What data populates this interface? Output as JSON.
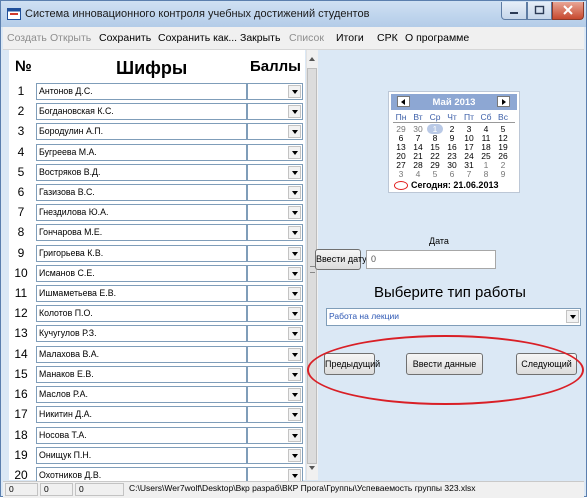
{
  "window": {
    "title": "Система инновационного контроля учебных достижений студентов",
    "controls": {
      "minimize_icon": "minimize-icon",
      "maximize_icon": "maximize-icon",
      "close_icon": "close-icon"
    }
  },
  "menu": [
    {
      "label": "Создать",
      "disabled": true
    },
    {
      "label": "Открыть",
      "disabled": true
    },
    {
      "label": "Сохранить",
      "disabled": false
    },
    {
      "label": "Сохранить как...",
      "disabled": false
    },
    {
      "label": "Закрыть",
      "disabled": false
    },
    {
      "label": "Список",
      "disabled": true
    },
    {
      "label": "Итоги",
      "disabled": false
    },
    {
      "label": "СРК",
      "disabled": false
    },
    {
      "label": "О программе",
      "disabled": false
    }
  ],
  "table": {
    "headers": {
      "num": "№",
      "code": "Шифры",
      "score": "Баллы"
    },
    "rows": [
      {
        "num": "1",
        "name": "Антонов Д.С."
      },
      {
        "num": "2",
        "name": "Богдановская К.С."
      },
      {
        "num": "3",
        "name": "Бородулин А.П."
      },
      {
        "num": "4",
        "name": "Бугреева М.А."
      },
      {
        "num": "5",
        "name": "Востряков В.Д."
      },
      {
        "num": "6",
        "name": "Газизова В.С."
      },
      {
        "num": "7",
        "name": "Гнездилова Ю.А."
      },
      {
        "num": "8",
        "name": "Гончарова М.Е."
      },
      {
        "num": "9",
        "name": "Григорьева К.В."
      },
      {
        "num": "10",
        "name": "Исманов С.Е."
      },
      {
        "num": "11",
        "name": "Ишмаметьева Е.В."
      },
      {
        "num": "12",
        "name": "Колотов П.О."
      },
      {
        "num": "13",
        "name": "Кучугулов Р.З."
      },
      {
        "num": "14",
        "name": "Малахова В.А."
      },
      {
        "num": "15",
        "name": "Манаков Е.В."
      },
      {
        "num": "16",
        "name": "Маслов Р.А."
      },
      {
        "num": "17",
        "name": "Никитин Д.А."
      },
      {
        "num": "18",
        "name": "Носова Т.А."
      },
      {
        "num": "19",
        "name": "Онищук П.Н."
      },
      {
        "num": "20",
        "name": "Охотников Д.В."
      }
    ]
  },
  "calendar": {
    "month_label": "Май 2013",
    "weekdays": [
      "Пн",
      "Вт",
      "Ср",
      "Чт",
      "Пт",
      "Сб",
      "Вс"
    ],
    "weeks": [
      [
        "29",
        "30",
        "1",
        "2",
        "3",
        "4",
        "5"
      ],
      [
        "6",
        "7",
        "8",
        "9",
        "10",
        "11",
        "12"
      ],
      [
        "13",
        "14",
        "15",
        "16",
        "17",
        "18",
        "19"
      ],
      [
        "20",
        "21",
        "22",
        "23",
        "24",
        "25",
        "26"
      ],
      [
        "27",
        "28",
        "29",
        "30",
        "31",
        "1",
        "2"
      ],
      [
        "3",
        "4",
        "5",
        "6",
        "7",
        "8",
        "9"
      ]
    ],
    "today_label": "Сегодня: 21.06.2013",
    "header_color": "#8da7d3"
  },
  "date": {
    "label": "Дата",
    "button": "Ввести дату",
    "value": "0"
  },
  "worktype": {
    "label": "Выберите тип работы",
    "selected": "Работа на лекции"
  },
  "actions": {
    "prev": "Предыдущий",
    "submit": "Ввести данные",
    "next": "Следующий"
  },
  "status": {
    "panels": [
      "0",
      "0",
      "0"
    ],
    "path": "C:\\Users\\Wer7wolf\\Desktop\\Вкр разраб\\ВКР Прога\\Группы\\Успеваемость группы 323.xlsx"
  },
  "colors": {
    "window_bg": "#dbe8f5",
    "annotation": "#d91f26",
    "accent": "#2d57b4"
  }
}
